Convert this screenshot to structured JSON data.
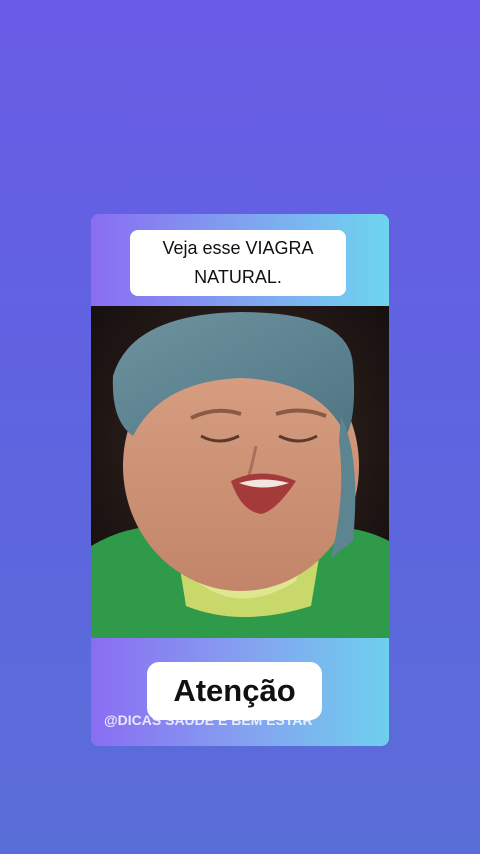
{
  "overlay": {
    "top_caption": "Veja esse VIAGRA NATURAL.",
    "bottom_caption": "Atenção",
    "watermark": "@DICAS SAÚDE E BEM ESTAR"
  },
  "colors": {
    "background_top": "#6a5ce6",
    "background_bottom": "#5a6ed8",
    "card_accent": "#6fd3ee"
  }
}
